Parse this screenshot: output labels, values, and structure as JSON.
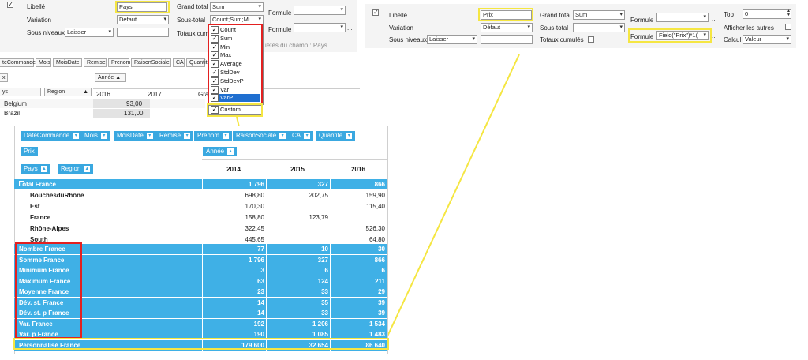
{
  "left_panel": {
    "libelle_label": "Libellé",
    "libelle_value": "Pays",
    "variation_label": "Variation",
    "variation_value": "Défaut",
    "sous_niveaux_label": "Sous niveaux",
    "sous_niveaux_value": "Laisser",
    "grand_total_label": "Grand total",
    "grand_total_value": "Sum",
    "sous_total_label": "Sous-total",
    "sous_total_value": "Count;Sum;Mi",
    "totaux_label": "Totaux cumu",
    "formule_label_1": "Formule",
    "formule_label_2": "Formule",
    "ellipsis": "...",
    "field_props": "iétés du champ : Pays",
    "field_buttons": [
      "teCommande",
      "Mois",
      "MoisDate",
      "Remise",
      "Prenom",
      "RaisonSociale",
      "CA",
      "Quantit"
    ],
    "annee_chip": "Année",
    "x_chip": "x",
    "pays_chip": "ys",
    "region_chip": "Region",
    "year_headers": [
      "2016",
      "2017",
      "Gra"
    ],
    "rows": [
      {
        "label": "Belgium",
        "value": "93,00"
      },
      {
        "label": "Brazil",
        "value": "131,00"
      }
    ]
  },
  "dropdown": {
    "items": [
      "Count",
      "Sum",
      "Min",
      "Max",
      "Average",
      "StdDev",
      "StdDevP",
      "Var",
      "VarP"
    ],
    "custom_item": "Custom"
  },
  "right_panel": {
    "libelle_label": "Libellé",
    "libelle_value": "Prix",
    "variation_label": "Variation",
    "variation_value": "Défaut",
    "sous_niveaux_label": "Sous niveaux",
    "sous_niveaux_value": "Laisser",
    "grand_total_label": "Grand total",
    "grand_total_value": "Sum",
    "sous_total_label": "Sous-total",
    "totaux_label": "Totaux cumulés",
    "formule_label_1": "Formule",
    "formule_label_2": "Formule",
    "formule_value": "Field(\"Prix\")*1(",
    "top_label": "Top",
    "top_value": "0",
    "afficher_label": "Afficher les autres",
    "calcul_label": "Calcul",
    "calcul_value": "Valeur",
    "ellipsis": "..."
  },
  "pivot": {
    "field_chips": [
      "DateCommande",
      "Mois",
      "MoisDate",
      "Remise",
      "Prenom",
      "RaisonSociale",
      "CA",
      "Quantite"
    ],
    "data_chip": "Prix",
    "col_chip": "Année",
    "row_chips": [
      "Pays",
      "Region"
    ],
    "years": [
      "2014",
      "2015",
      "2016"
    ],
    "total_row": {
      "label": "Total France",
      "values": [
        "1 796",
        "327",
        "866"
      ]
    },
    "detail_rows": [
      {
        "label": "BouchesduRhône",
        "values": [
          "698,80",
          "202,75",
          "159,90"
        ]
      },
      {
        "label": "Est",
        "values": [
          "170,30",
          "",
          "115,40"
        ]
      },
      {
        "label": "France",
        "values": [
          "158,80",
          "123,79",
          ""
        ]
      },
      {
        "label": "Rhône-Alpes",
        "values": [
          "322,45",
          "",
          "526,30"
        ]
      },
      {
        "label": "South",
        "values": [
          "445,65",
          "",
          "64,80"
        ]
      }
    ],
    "stat_rows": [
      {
        "label": "Nombre France",
        "values": [
          "77",
          "10",
          "30"
        ]
      },
      {
        "label": "Somme France",
        "values": [
          "1 796",
          "327",
          "866"
        ]
      },
      {
        "label": "Minimum France",
        "values": [
          "3",
          "6",
          "6"
        ]
      },
      {
        "label": "Maximum France",
        "values": [
          "63",
          "124",
          "211"
        ]
      },
      {
        "label": "Moyenne France",
        "values": [
          "23",
          "33",
          "29"
        ]
      },
      {
        "label": "Dév. st. France",
        "values": [
          "14",
          "35",
          "39"
        ]
      },
      {
        "label": "Dév. st. p France",
        "values": [
          "14",
          "33",
          "39"
        ]
      },
      {
        "label": "Var. France",
        "values": [
          "192",
          "1 206",
          "1 534"
        ]
      },
      {
        "label": "Var. p France",
        "values": [
          "190",
          "1 085",
          "1 483"
        ]
      }
    ],
    "custom_row": {
      "label": "Personnalisé France",
      "values": [
        "179 600",
        "32 654",
        "86 640"
      ]
    }
  },
  "colors": {
    "pivot_blue": "#3fb0e6",
    "highlight_yellow": "#f5e642",
    "highlight_red": "#e32020",
    "selected_blue": "#1f6fd0"
  }
}
